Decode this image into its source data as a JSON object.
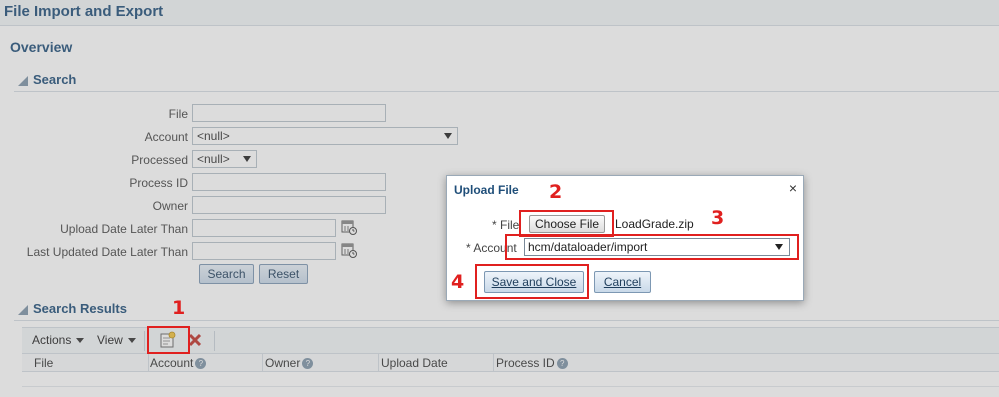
{
  "page": {
    "title": "File Import and Export",
    "overview": "Overview"
  },
  "search": {
    "header": "Search",
    "fields": {
      "file_label": "File",
      "file_value": "",
      "account_label": "Account",
      "account_value": "<null>",
      "processed_label": "Processed",
      "processed_value": "<null>",
      "process_id_label": "Process ID",
      "process_id_value": "",
      "owner_label": "Owner",
      "owner_value": "",
      "upload_date_label": "Upload Date Later Than",
      "upload_date_value": "",
      "last_updated_label": "Last Updated Date Later Than",
      "last_updated_value": ""
    },
    "search_btn": "Search",
    "reset_btn": "Reset"
  },
  "results": {
    "header": "Search Results",
    "toolbar": {
      "actions": "Actions",
      "view": "View"
    },
    "columns": [
      "File",
      "Account",
      "Owner",
      "Upload Date",
      "Process ID"
    ]
  },
  "dialog": {
    "title": "Upload File",
    "close": "×",
    "file_label": "* File",
    "choose_btn": "Choose File",
    "file_name": "LoadGrade.zip",
    "account_label": "* Account",
    "account_value": "hcm/dataloader/import",
    "save_btn": "Save and Close",
    "cancel_btn": "Cancel"
  },
  "annotations": [
    "1",
    "2",
    "3",
    "4"
  ],
  "colors": {
    "accent": "#1f4e79",
    "annotation": "#e0201f"
  }
}
